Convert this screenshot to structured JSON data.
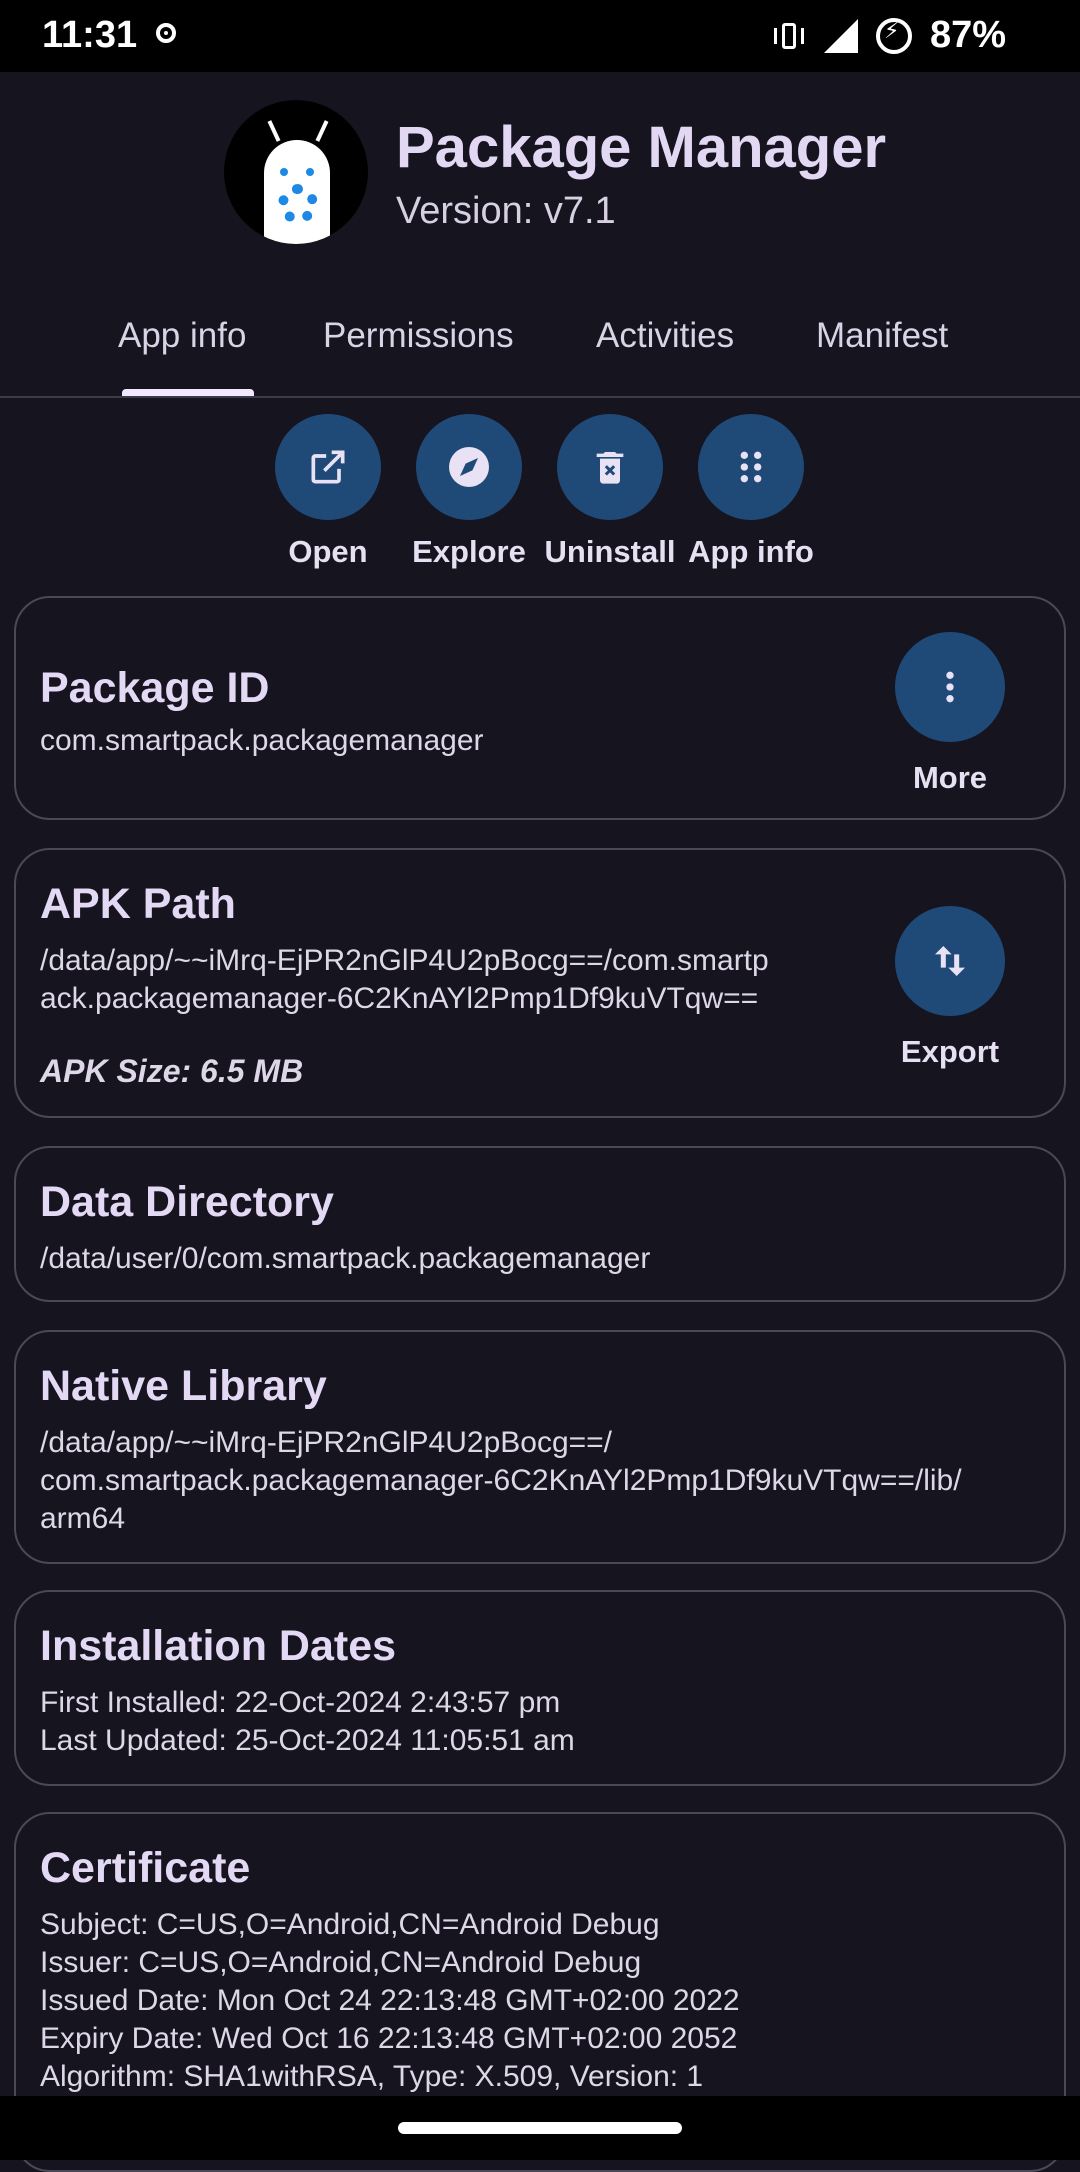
{
  "status": {
    "time": "11:31",
    "battery": "87%"
  },
  "app": {
    "title": "Package Manager",
    "version": "Version: v7.1"
  },
  "tabs": [
    {
      "label": "App info"
    },
    {
      "label": "Permissions"
    },
    {
      "label": "Activities"
    },
    {
      "label": "Manifest"
    }
  ],
  "actions": [
    {
      "label": "Open",
      "icon": "open-external-icon"
    },
    {
      "label": "Explore",
      "icon": "compass-icon"
    },
    {
      "label": "Uninstall",
      "icon": "trash-icon"
    },
    {
      "label": "App info",
      "icon": "dots-grid-icon"
    }
  ],
  "package_id": {
    "title": "Package ID",
    "value": "com.smartpack.packagemanager",
    "button": "More"
  },
  "apk_path": {
    "title": "APK Path",
    "line1": "/data/app/~~iMrq-EjPR2nGlP4U2pBocg==/com.smartp",
    "line2": "ack.packagemanager-6C2KnAYl2Pmp1Df9kuVTqw==",
    "size": "APK Size: 6.5 MB",
    "button": "Export"
  },
  "data_directory": {
    "title": "Data Directory",
    "value": "/data/user/0/com.smartpack.packagemanager"
  },
  "native_library": {
    "title": "Native Library",
    "line1": "/data/app/~~iMrq-EjPR2nGlP4U2pBocg==/",
    "line2": "com.smartpack.packagemanager-6C2KnAYl2Pmp1Df9kuVTqw==/lib/",
    "line3": "arm64"
  },
  "installation_dates": {
    "title": "Installation Dates",
    "first": "First Installed: 22-Oct-2024 2:43:57 pm",
    "last": "Last Updated: 25-Oct-2024 11:05:51 am"
  },
  "certificate": {
    "title": "Certificate",
    "subject": "Subject: C=US,O=Android,CN=Android Debug",
    "issuer": "Issuer: C=US,O=Android,CN=Android Debug",
    "issued": "Issued Date: Mon Oct 24 22:13:48 GMT+02:00 2022",
    "expiry": "Expiry Date: Wed Oct 16 22:13:48 GMT+02:00 2052",
    "algorithm": "Algorithm: SHA1withRSA, Type: X.509, Version: 1"
  },
  "colors": {
    "background": "#15141f",
    "accent_button": "#1f4a78",
    "card_border": "#4b4857"
  }
}
